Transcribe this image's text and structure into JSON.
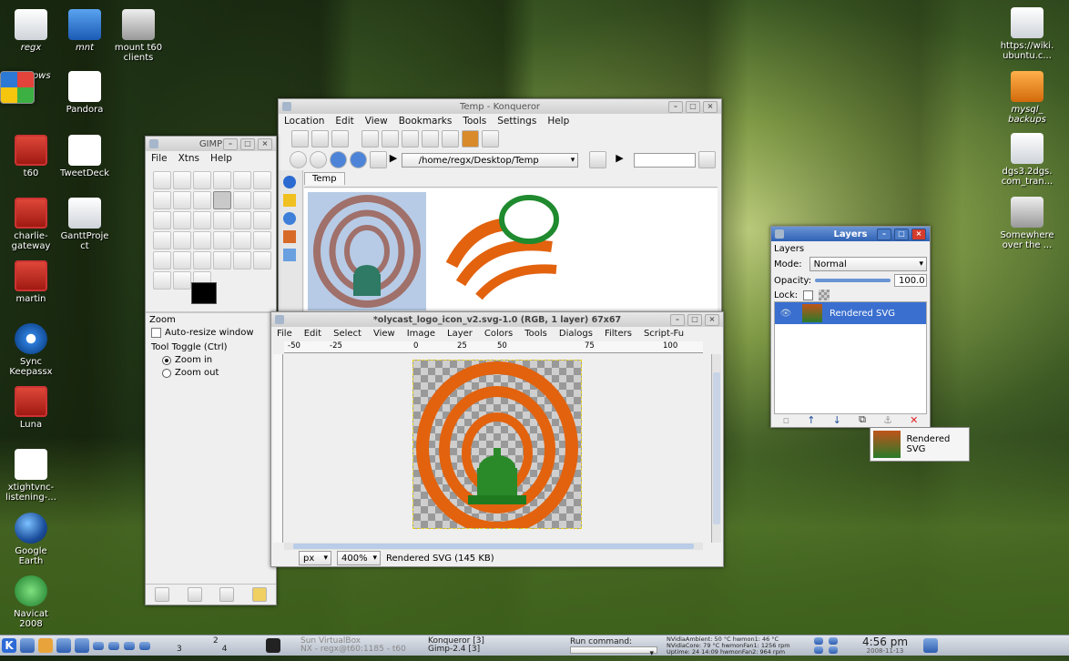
{
  "desktop_icons_left": [
    {
      "label": "regx",
      "italic": true,
      "icon": "igloo-icon"
    },
    {
      "label": "mnt",
      "italic": true,
      "icon": "folder-icon"
    },
    {
      "label": "mount t60\nclients",
      "italic": false,
      "icon": "drive-icon"
    },
    {
      "label": "windows",
      "italic": true,
      "icon": "windows-icon"
    },
    {
      "label": "Pandora",
      "italic": false,
      "icon": "pandora-icon"
    },
    {
      "label": "t60",
      "italic": false,
      "icon": "rdp-icon"
    },
    {
      "label": "TweetDeck",
      "italic": false,
      "icon": "tweetdeck-icon"
    },
    {
      "label": "charlie-\ngateway",
      "italic": false,
      "icon": "rdp-icon"
    },
    {
      "label": "GanttProje\nct",
      "italic": false,
      "icon": "ganttproject-icon"
    },
    {
      "label": "martin",
      "italic": false,
      "icon": "rdp-icon"
    },
    {
      "label": "Sync\nKeepassx",
      "italic": false,
      "icon": "gear-icon"
    },
    {
      "label": "Luna",
      "italic": false,
      "icon": "rdp-icon"
    },
    {
      "label": "xtightvnc-\nlistening-...",
      "italic": false,
      "icon": "vnc-icon"
    },
    {
      "label": "Google\nEarth",
      "italic": false,
      "icon": "earth-icon"
    },
    {
      "label": "Navicat\n2008",
      "italic": false,
      "icon": "navicat-icon"
    }
  ],
  "desktop_icons_right": [
    {
      "label": "https://wiki.\nubuntu.c...",
      "italic": false,
      "icon": "document-icon"
    },
    {
      "label": "mysql_\nbackups",
      "italic": true,
      "icon": "folder-icon"
    },
    {
      "label": "dgs3.2dgs.\ncom_tran...",
      "italic": false,
      "icon": "text-file-icon"
    },
    {
      "label": "Somewhere\nover the ...",
      "italic": false,
      "icon": "audio-icon"
    }
  ],
  "konqueror": {
    "title": "Temp - Konqueror",
    "menu": [
      "Location",
      "Edit",
      "View",
      "Bookmarks",
      "Tools",
      "Settings",
      "Help"
    ],
    "path": "/home/regx/Desktop/Temp",
    "tab": "Temp"
  },
  "gimp_toolbox": {
    "title": "GIMP",
    "menu": [
      "File",
      "Xtns",
      "Help"
    ],
    "options_title": "Zoom",
    "auto_resize": "Auto-resize window",
    "toggle_label": "Tool Toggle  (Ctrl)",
    "zoom_in": "Zoom in",
    "zoom_out": "Zoom out"
  },
  "image_window": {
    "title": "*olycast_logo_icon_v2.svg-1.0 (RGB, 1 layer) 67x67",
    "menu": [
      "File",
      "Edit",
      "Select",
      "View",
      "Image",
      "Layer",
      "Colors",
      "Tools",
      "Dialogs",
      "Filters",
      "Script-Fu"
    ],
    "ruler_ticks": [
      "-50",
      "-25",
      "0",
      "25",
      "50",
      "75",
      "100"
    ],
    "unit": "px",
    "zoom": "400%",
    "status": "Rendered SVG (145 KB)"
  },
  "layers": {
    "title": "Layers",
    "panel_label": "Layers",
    "mode_label": "Mode:",
    "mode_value": "Normal",
    "opacity_label": "Opacity:",
    "opacity_value": "100.0",
    "opacity_fraction": 1.0,
    "lock_label": "Lock:",
    "layer_name": "Rendered SVG",
    "drag_label": "Rendered SVG"
  },
  "taskbar": {
    "pager_numbers": [
      "2",
      "3",
      "4"
    ],
    "tasks": [
      {
        "line1": "Sun VirtualBox",
        "line2": "NX - regx@t60:1185 - t60",
        "dim": true
      },
      {
        "line1": "Konqueror [3]",
        "line2": "Gimp-2.4 [3]",
        "dim": false
      }
    ],
    "run_label": "Run command:",
    "sensors": [
      "NVidiaAmbient: 50 °C   hwmon1: 46 °C",
      "NVidiaCore: 79 °C   hwmonFan1: 1256 rpm",
      "Uptime: 24 14:09   hwmonFan2: 964 rpm"
    ],
    "clock": "4:56 pm",
    "date": "2008-11-13"
  },
  "colors": {
    "title_active": "#2f62b5",
    "layer_selected": "#3a6fcf",
    "logo_orange": "#e2620e",
    "logo_green": "#2a8a2a"
  }
}
